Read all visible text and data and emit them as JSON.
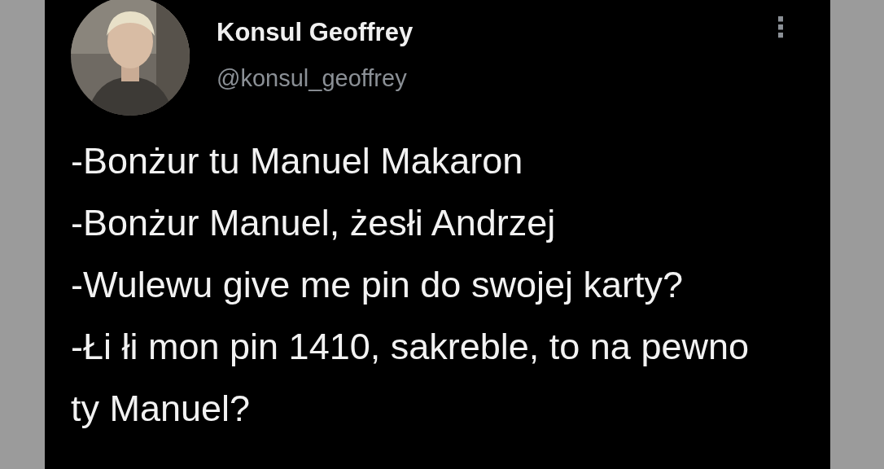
{
  "tweet": {
    "author": {
      "name": "Konsul Geoffrey",
      "handle": "@konsul_geoffrey"
    },
    "menu_icon": "⋮",
    "lines": [
      "-Bonżur tu Manuel Makaron",
      "-Bonżur Manuel, żesłi Andrzej",
      "-Wulewu give me pin do swojej karty?",
      "-Łi łi mon pin 1410, sakreble, to na pewno ty Manuel?"
    ]
  }
}
